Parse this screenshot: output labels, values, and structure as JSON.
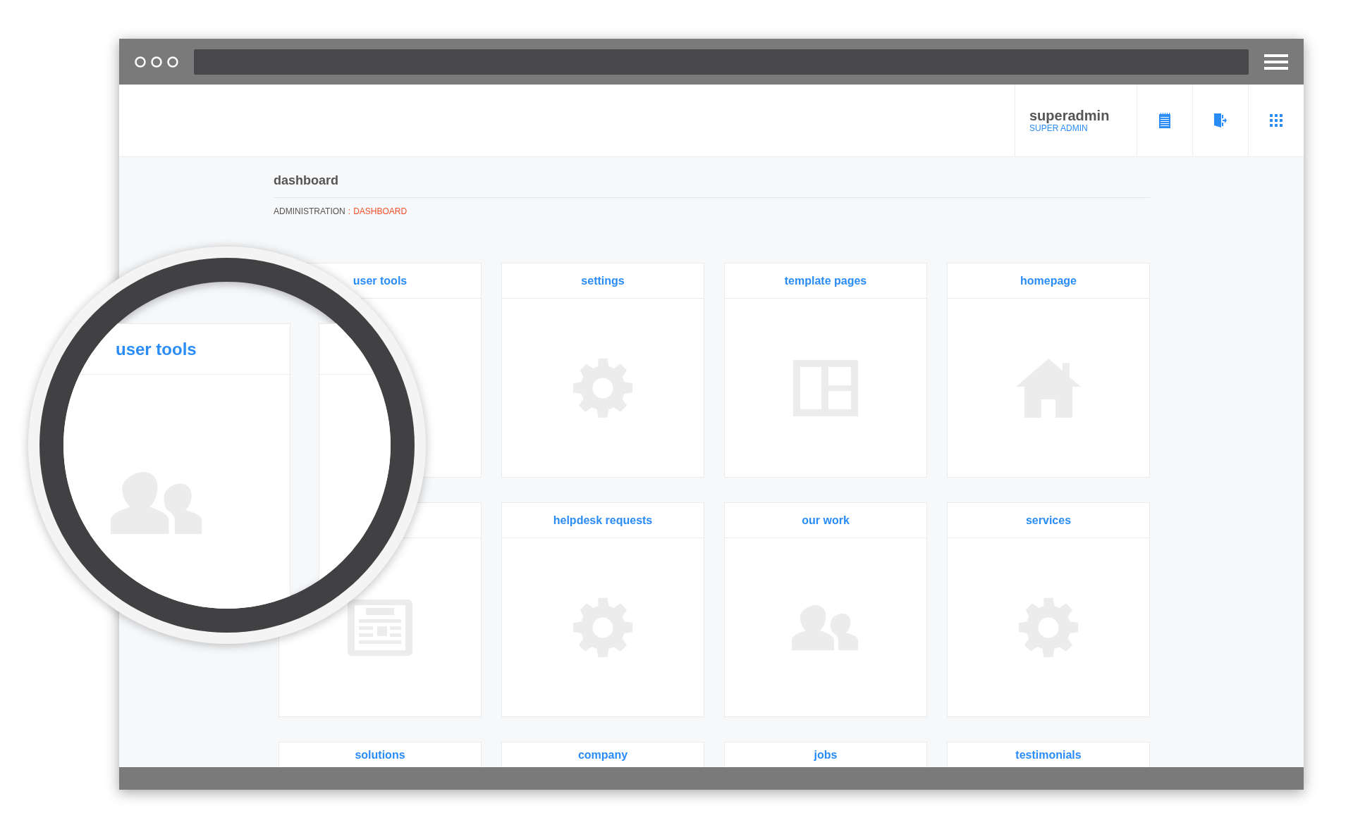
{
  "header": {
    "user_name": "superadmin",
    "user_role": "SUPER ADMIN",
    "icons": [
      {
        "kind": "notepad"
      },
      {
        "kind": "logout"
      },
      {
        "kind": "grid"
      }
    ]
  },
  "page": {
    "title": "dashboard",
    "breadcrumb": [
      {
        "label": "ADMINISTRATION",
        "selected": false
      },
      {
        "label": "DASHBOARD",
        "selected": true
      }
    ],
    "breadcrumb_separator": ":"
  },
  "tiles": [
    {
      "title": "user tools"
    },
    {
      "title": "settings",
      "kind": "gear"
    },
    {
      "title": "template pages",
      "kind": "layout"
    },
    {
      "title": "homepage",
      "kind": "home"
    },
    {
      "kind": "news"
    },
    {
      "title": "helpdesk requests",
      "kind": "gear"
    },
    {
      "title": "our work",
      "kind": "people"
    },
    {
      "title": "services",
      "kind": "gear"
    },
    {
      "title": "solutions"
    },
    {
      "title": "company"
    },
    {
      "title": "jobs"
    },
    {
      "title": "testimonials"
    }
  ],
  "magnifier": {
    "title": "user tools",
    "kind": "people"
  }
}
